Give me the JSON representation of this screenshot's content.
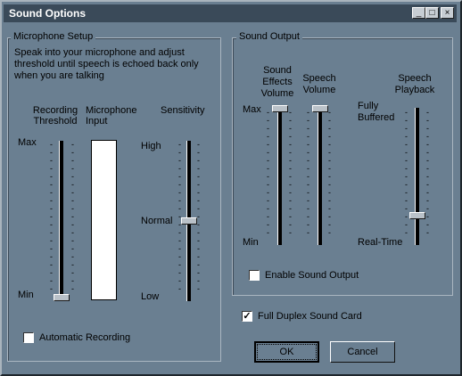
{
  "window": {
    "title": "Sound Options",
    "minimize": "_",
    "maximize": "□",
    "close": "×"
  },
  "mic": {
    "group_title": "Microphone Setup",
    "instructions": [
      "Speak into your microphone and adjust",
      "threshold until speech is echoed back only",
      "when you are talking"
    ],
    "threshold_label": [
      "Recording",
      "Threshold"
    ],
    "input_label": [
      "Microphone",
      "Input"
    ],
    "sensitivity_label": "Sensitivity",
    "max": "Max",
    "min": "Min",
    "high": "High",
    "normal": "Normal",
    "low": "Low",
    "threshold_level": 0.0,
    "sensitivity_level": 0.5,
    "auto_recording_label": "Automatic Recording",
    "auto_recording_checked": false
  },
  "output": {
    "group_title": "Sound Output",
    "effects_label": [
      "Sound",
      "Effects",
      "Volume"
    ],
    "speech_label": [
      "Speech",
      "Volume"
    ],
    "playback_label": [
      "Speech",
      "Playback"
    ],
    "max": "Max",
    "min": "Min",
    "fully_buffered": [
      "Fully",
      "Buffered"
    ],
    "realtime": "Real-Time",
    "effects_level": 1.0,
    "speech_level": 1.0,
    "playback_level": 0.2,
    "enable_label": "Enable Sound Output",
    "enable_checked": false
  },
  "full_duplex_label": "Full Duplex Sound Card",
  "full_duplex_checked": true,
  "ok_label": "OK",
  "cancel_label": "Cancel",
  "colors": {
    "face": "#6a7f91",
    "title_bar": "#3a4a59"
  }
}
